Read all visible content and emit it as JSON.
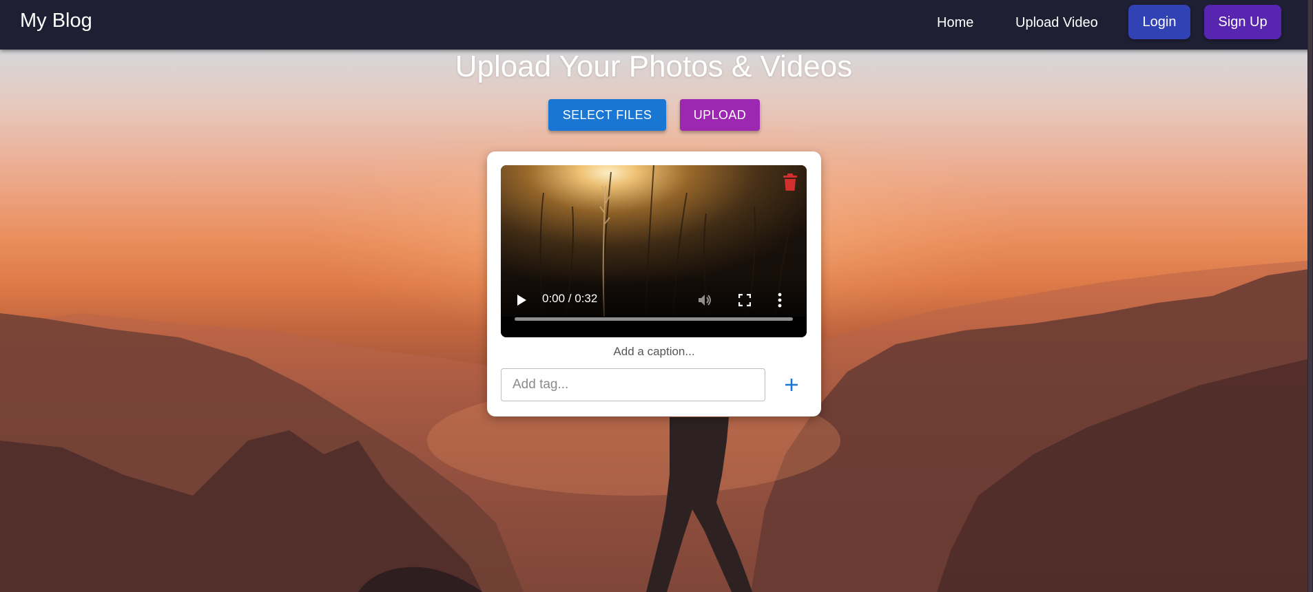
{
  "navbar": {
    "brand": "My Blog",
    "links": {
      "home": "Home",
      "upload_video": "Upload Video"
    },
    "login": "Login",
    "signup": "Sign Up"
  },
  "page": {
    "heading": "Upload Your Photos & Videos",
    "select_files": "SELECT FILES",
    "upload": "UPLOAD"
  },
  "card": {
    "video": {
      "time": "0:00 / 0:32",
      "progress": 0,
      "icons": [
        "play-icon",
        "volume-icon",
        "fullscreen-icon",
        "more-vert-icon",
        "trash-icon"
      ]
    },
    "caption_placeholder": "Add a caption...",
    "tag_placeholder": "Add tag...",
    "add_tag_icon": "plus-icon"
  },
  "colors": {
    "navbar": "#1e1f33",
    "login": "#3142b4",
    "signup": "#5725b0",
    "select_files": "#1976d2",
    "upload": "#9c27b0",
    "delete": "#d32f2f",
    "add_tag": "#1976d2"
  }
}
